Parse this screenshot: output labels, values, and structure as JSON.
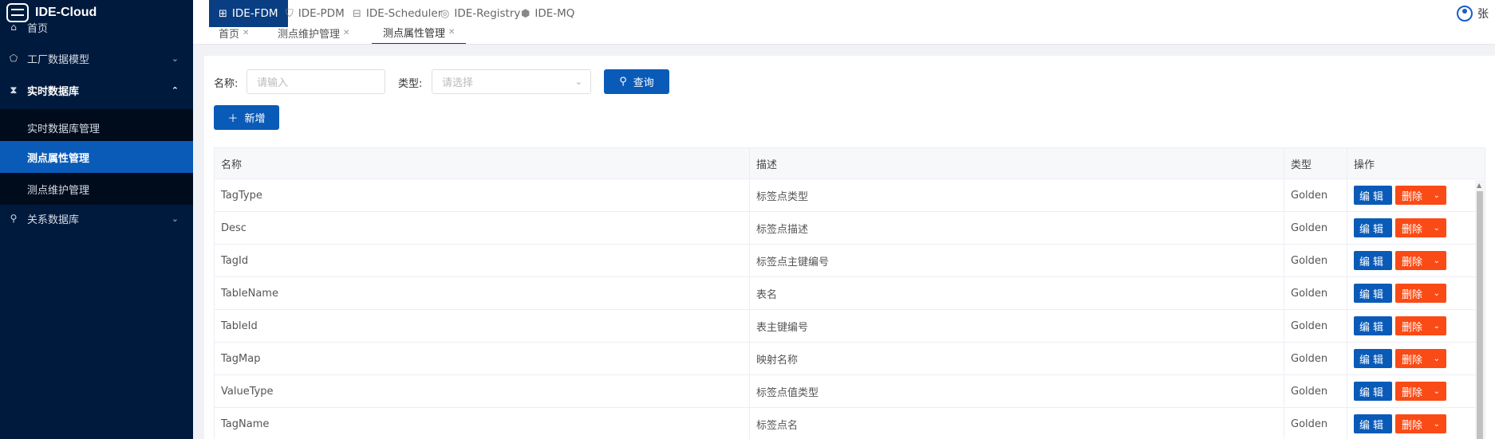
{
  "brand": {
    "name": "IDE-Cloud",
    "icon": "ide-cloud-logo"
  },
  "sidebar": {
    "home": {
      "label": "首页",
      "icon": "home-icon"
    },
    "items": [
      {
        "label": "工厂数据模型",
        "icon": "factory-icon",
        "expanded": false
      },
      {
        "label": "实时数据库",
        "icon": "hourglass-icon",
        "expanded": true
      },
      {
        "label": "关系数据库",
        "icon": "link-icon",
        "expanded": false
      }
    ],
    "subitems": [
      {
        "label": "实时数据库管理",
        "active": false
      },
      {
        "label": "测点属性管理",
        "active": true
      },
      {
        "label": "测点维护管理",
        "active": false
      }
    ]
  },
  "topbar": {
    "apps": [
      {
        "label": "IDE-FDM",
        "icon": "grid-icon",
        "active": true
      },
      {
        "label": "IDE-PDM",
        "icon": "bag-icon",
        "active": false
      },
      {
        "label": "IDE-Scheduler",
        "icon": "scheduler-icon",
        "active": false
      },
      {
        "label": "IDE-Registry",
        "icon": "registry-icon",
        "active": false
      },
      {
        "label": "IDE-MQ",
        "icon": "cube-icon",
        "active": false
      }
    ],
    "user": {
      "name": "张",
      "icon": "user-icon"
    }
  },
  "tabs": [
    {
      "label": "首页"
    },
    {
      "label": "测点维护管理"
    },
    {
      "label": "测点属性管理",
      "active": true
    }
  ],
  "filters": {
    "name_label": "名称:",
    "name_placeholder": "请输入",
    "type_label": "类型:",
    "type_placeholder": "请选择",
    "search_label": "查询",
    "add_label": "新增"
  },
  "table": {
    "columns": [
      "名称",
      "描述",
      "类型",
      "操作"
    ],
    "edit_label": "编辑",
    "delete_label": "删除",
    "rows": [
      {
        "name": "TagType",
        "desc": "标签点类型",
        "type": "Golden"
      },
      {
        "name": "Desc",
        "desc": "标签点描述",
        "type": "Golden"
      },
      {
        "name": "TagId",
        "desc": "标签点主键编号",
        "type": "Golden"
      },
      {
        "name": "TableName",
        "desc": "表名",
        "type": "Golden"
      },
      {
        "name": "TableId",
        "desc": "表主键编号",
        "type": "Golden"
      },
      {
        "name": "TagMap",
        "desc": "映射名称",
        "type": "Golden"
      },
      {
        "name": "ValueType",
        "desc": "标签点值类型",
        "type": "Golden"
      },
      {
        "name": "TagName",
        "desc": "标签点名",
        "type": "Golden"
      }
    ]
  },
  "colors": {
    "sidebar_bg": "#001a3d",
    "primary": "#0a5bb8",
    "danger": "#fa4b16",
    "active_app": "#0a3e82"
  }
}
